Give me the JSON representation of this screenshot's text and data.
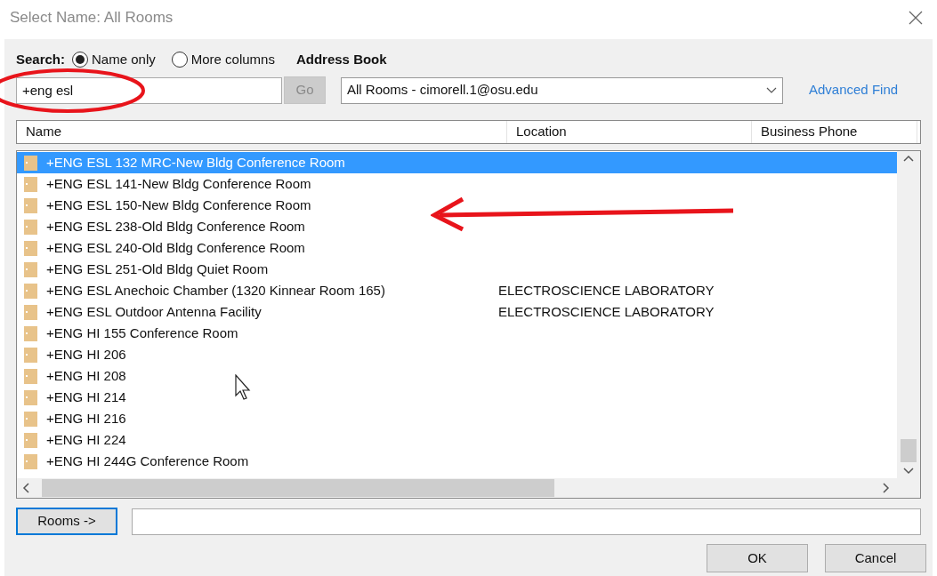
{
  "window": {
    "title": "Select Name: All Rooms"
  },
  "search": {
    "label": "Search:",
    "value": "+eng esl",
    "go_button": {
      "label": "Go",
      "disabled": true
    },
    "options": [
      {
        "label": "Name only",
        "selected": true
      },
      {
        "label": "More columns",
        "selected": false
      }
    ]
  },
  "address_book": {
    "label": "Address Book",
    "value": "All Rooms - cimorell.1@osu.edu",
    "link": "Advanced Find"
  },
  "table": {
    "columns": [
      "Name",
      "Location",
      "Business Phone"
    ],
    "rows": [
      {
        "name": "+ENG ESL 132 MRC-New Bldg Conference Room",
        "location": "",
        "selected": true
      },
      {
        "name": "+ENG ESL 141-New Bldg Conference Room",
        "location": "",
        "selected": false
      },
      {
        "name": "+ENG ESL 150-New Bldg Conference Room",
        "location": "",
        "selected": false
      },
      {
        "name": "+ENG ESL 238-Old Bldg Conference Room",
        "location": "",
        "selected": false
      },
      {
        "name": "+ENG ESL 240-Old Bldg Conference Room",
        "location": "",
        "selected": false
      },
      {
        "name": "+ENG ESL 251-Old Bldg Quiet Room",
        "location": "",
        "selected": false
      },
      {
        "name": "+ENG ESL Anechoic Chamber (1320 Kinnear Room 165)",
        "location": "ELECTROSCIENCE LABORATORY",
        "selected": false
      },
      {
        "name": "+ENG ESL Outdoor Antenna Facility",
        "location": "ELECTROSCIENCE LABORATORY",
        "selected": false
      },
      {
        "name": "+ENG HI 155 Conference Room",
        "location": "",
        "selected": false
      },
      {
        "name": "+ENG HI 206",
        "location": "",
        "selected": false
      },
      {
        "name": "+ENG HI 208",
        "location": "",
        "selected": false
      },
      {
        "name": "+ENG HI 214",
        "location": "",
        "selected": false
      },
      {
        "name": "+ENG HI 216",
        "location": "",
        "selected": false
      },
      {
        "name": "+ENG HI 224",
        "location": "",
        "selected": false
      },
      {
        "name": "+ENG HI 244G Conference Room",
        "location": "",
        "selected": false
      }
    ]
  },
  "rooms_button": "Rooms ->",
  "buttons": [
    "OK",
    "Cancel"
  ]
}
